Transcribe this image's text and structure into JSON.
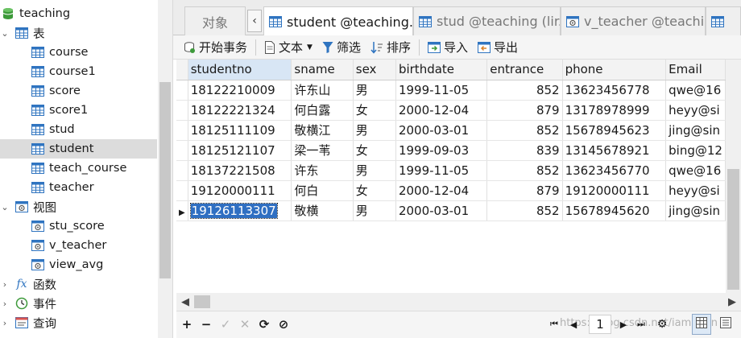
{
  "tree": {
    "database": "teaching",
    "tables_group": "表",
    "tables": [
      "course",
      "course1",
      "score",
      "score1",
      "stud",
      "student",
      "teach_course",
      "teacher"
    ],
    "selected_table": "student",
    "views_group": "视图",
    "views": [
      "stu_score",
      "v_teacher",
      "view_avg"
    ],
    "functions_group": "函数",
    "events_group": "事件",
    "queries_group": "查询"
  },
  "tabs": {
    "objects": "对象",
    "active": "student @teaching...",
    "stud": "stud @teaching (lir...",
    "v_teacher": "v_teacher @teachi..."
  },
  "toolbar": {
    "begin_transaction": "开始事务",
    "text": "文本",
    "filter": "筛选",
    "sort": "排序",
    "import": "导入",
    "export": "导出"
  },
  "grid": {
    "columns": [
      "studentno",
      "sname",
      "sex",
      "birthdate",
      "entrance",
      "phone",
      "Email"
    ],
    "rows": [
      [
        "18122210009",
        "许东山",
        "男",
        "1999-11-05",
        "852",
        "13623456778",
        "qwe@16"
      ],
      [
        "18122221324",
        "何白露",
        "女",
        "2000-12-04",
        "879",
        "13178978999",
        "heyy@si"
      ],
      [
        "18125111109",
        "敬横江",
        "男",
        "2000-03-01",
        "852",
        "15678945623",
        "jing@sin"
      ],
      [
        "18125121107",
        "梁一苇",
        "女",
        "1999-09-03",
        "839",
        "13145678921",
        "bing@12"
      ],
      [
        "18137221508",
        "许东",
        "男",
        "1999-11-05",
        "852",
        "13623456770",
        "qwe@16"
      ],
      [
        "19120000111",
        "何白",
        "女",
        "2000-12-04",
        "879",
        "19120000111",
        "heyy@si"
      ],
      [
        "19126113307",
        "敬横",
        "男",
        "2000-03-01",
        "852",
        "15678945620",
        "jing@sin"
      ]
    ],
    "selected_cell": "19126113307"
  },
  "bottombar": {
    "add": "+",
    "remove": "−",
    "confirm": "✓",
    "cancel": "✕",
    "refresh": "⟳",
    "stop": "⊘",
    "page": "1",
    "watermark": "https://blog.csdn.net/iamhuan"
  },
  "colors": {
    "selection_blue": "#2f6fc2",
    "sorted_header": "#d8e6f5",
    "tree_selected": "#dcdcdc",
    "db_green": "#3d9a3a",
    "table_icon_blue": "#2f74c0"
  }
}
